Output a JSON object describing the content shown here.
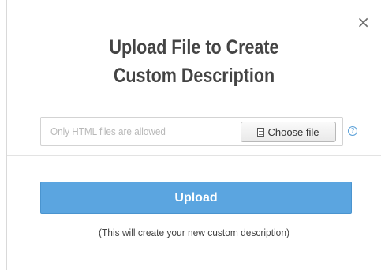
{
  "dialog": {
    "close_glyph": "×",
    "title_line1": "Upload File to Create",
    "title_line2": "Custom Description",
    "file_placeholder": "Only HTML files are allowed",
    "choose_file_label": "Choose file",
    "help_glyph": "?",
    "upload_label": "Upload",
    "note": "(This will create your new custom description)"
  },
  "colors": {
    "accent": "#5ba5e0",
    "title": "#444444",
    "placeholder": "#b8b8b8"
  },
  "icons": {
    "close": "close-icon",
    "file": "file-icon",
    "help": "help-icon"
  }
}
